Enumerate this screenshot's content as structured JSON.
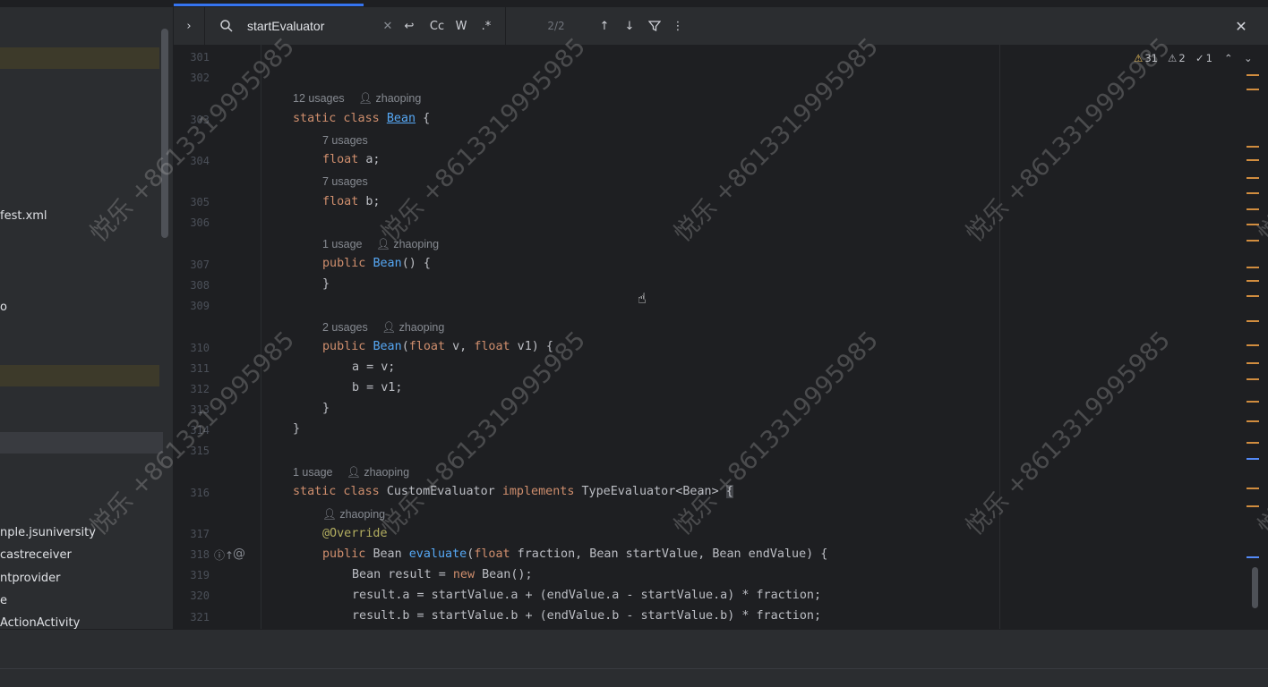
{
  "project_panel": {
    "items": [
      "fest.xml",
      "o",
      "nple.jsuniversity",
      "castreceiver",
      "ntprovider",
      "e",
      "ActionActivity"
    ]
  },
  "search": {
    "query": "startEvaluator",
    "match_case_label": "Cc",
    "words_label": "W",
    "regex_label": ".*",
    "match_count": "2/2"
  },
  "inspections": {
    "warnings": "31",
    "weak_warnings": "2",
    "typos": "1"
  },
  "editor": {
    "lines": [
      {
        "n": "301",
        "text": ""
      },
      {
        "n": "302",
        "text": ""
      },
      {
        "n": "303",
        "hint": "12 usages",
        "author": "zhaoping"
      },
      {
        "n": "304",
        "hint": "7 usages"
      },
      {
        "n": "305",
        "hint": "7 usages"
      },
      {
        "n": "306"
      },
      {
        "n": "307",
        "hint": "1 usage",
        "author": "zhaoping"
      },
      {
        "n": "308"
      },
      {
        "n": "309"
      },
      {
        "n": "310",
        "hint": "2 usages",
        "author": "zhaoping"
      },
      {
        "n": "311"
      },
      {
        "n": "312"
      },
      {
        "n": "313"
      },
      {
        "n": "314"
      },
      {
        "n": "315"
      },
      {
        "n": "316",
        "hint": "1 usage",
        "author": "zhaoping"
      },
      {
        "n": "317",
        "author": "zhaoping"
      },
      {
        "n": "318"
      },
      {
        "n": "319"
      },
      {
        "n": "320"
      },
      {
        "n": "321"
      }
    ],
    "code": {
      "l303a": "static class ",
      "l303b": "Bean",
      "l303c": " {",
      "l304a": "float ",
      "l304b": "a;",
      "l305a": "float ",
      "l305b": "b;",
      "l307a": "public ",
      "l307b": "Bean",
      "l307c": "() {",
      "l308": "}",
      "l310a": "public ",
      "l310b": "Bean",
      "l310c": "(",
      "l310d": "float",
      "l310e": " v, ",
      "l310f": "float",
      "l310g": " v1) {",
      "l311": "a = v;",
      "l312": "b = v1;",
      "l313": "}",
      "l314": "}",
      "l316a": "static class ",
      "l316b": "CustomEvaluator ",
      "l316c": "implements ",
      "l316d": "TypeEvaluator<Bean> ",
      "l316e": "{",
      "l317": "@Override",
      "l318a": "public ",
      "l318b": "Bean ",
      "l318c": "evaluate",
      "l318d": "(",
      "l318e": "float",
      "l318f": " fraction, Bean startValue, Bean endValue) {",
      "l319a": "Bean result = ",
      "l319b": "new ",
      "l319c": "Bean();",
      "l320": "result.a = startValue.a + (endValue.a - startValue.a) * fraction;",
      "l321": "result.b = startValue.b + (endValue.b - startValue.b) * fraction;"
    }
  },
  "watermark_text": "悦乐 +8613319995985",
  "colors": {
    "keyword": "#cf8e6d",
    "function": "#56a8f5",
    "annotation": "#b3ae60",
    "accent": "#3574f0"
  }
}
